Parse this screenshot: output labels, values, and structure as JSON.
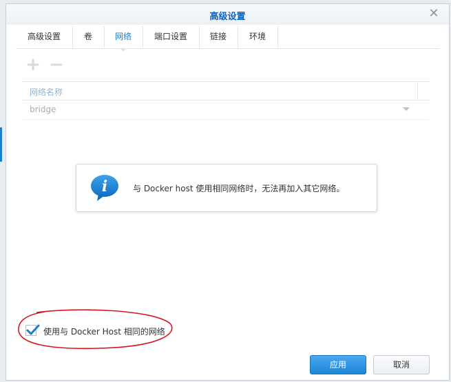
{
  "dialog": {
    "title": "高级设置",
    "close_icon": "close-icon"
  },
  "tabs": [
    {
      "label": "高级设置",
      "active": false
    },
    {
      "label": "卷",
      "active": false
    },
    {
      "label": "网络",
      "active": true
    },
    {
      "label": "端口设置",
      "active": false
    },
    {
      "label": "链接",
      "active": false
    },
    {
      "label": "环境",
      "active": false
    }
  ],
  "toolbar": {
    "add_icon": "plus-icon",
    "remove_icon": "minus-icon"
  },
  "network_grid": {
    "column_header": "网络名称",
    "rows": [
      {
        "name": "bridge"
      }
    ]
  },
  "info_message": {
    "icon": "info-icon",
    "text": "与 Docker host 使用相同网络时，无法再加入其它网络。"
  },
  "host_network_option": {
    "label": "使用与 Docker Host 相同的网络",
    "checked": true
  },
  "buttons": {
    "apply": "应用",
    "cancel": "取消"
  },
  "colors": {
    "accent": "#1b7fcc",
    "annotation": "#d8141c"
  }
}
